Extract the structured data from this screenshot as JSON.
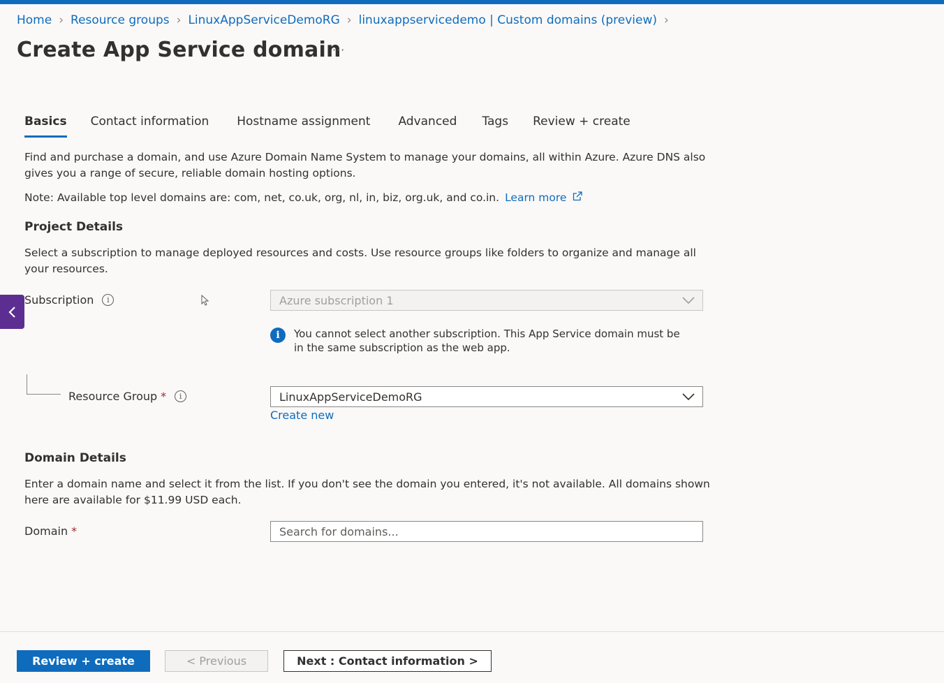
{
  "breadcrumb": {
    "items": [
      "Home",
      "Resource groups",
      "LinuxAppServiceDemoRG",
      "linuxappservicedemo | Custom domains (preview)"
    ]
  },
  "page": {
    "title": "Create App Service domain",
    "more": "···"
  },
  "tabs": [
    {
      "label": "Basics",
      "active": true
    },
    {
      "label": "Contact information"
    },
    {
      "label": "Hostname assignment"
    },
    {
      "label": "Advanced"
    },
    {
      "label": "Tags"
    },
    {
      "label": "Review + create"
    }
  ],
  "intro": {
    "description": "Find and purchase a domain, and use Azure Domain Name System to manage your domains, all within Azure. Azure DNS also gives you a range of secure, reliable domain hosting options.",
    "note": "Note: Available top level domains are: com, net, co.uk, org, nl, in, biz, org.uk, and co.in.",
    "learn_more": "Learn more"
  },
  "project": {
    "heading": "Project Details",
    "description": "Select a subscription to manage deployed resources and costs. Use resource groups like folders to organize and manage all your resources.",
    "subscription_label": "Subscription",
    "subscription_value": "Azure subscription 1",
    "subscription_info": "You cannot select another subscription. This App Service domain must be in the same subscription as the web app.",
    "rg_label": "Resource Group",
    "rg_value": "LinuxAppServiceDemoRG",
    "create_new": "Create new",
    "required_mark": "*",
    "info_glyph": "i"
  },
  "domain": {
    "heading": "Domain Details",
    "description": "Enter a domain name and select it from the list. If you don't see the domain you entered, it's not available. All domains shown here are available for $11.99 USD each.",
    "label": "Domain",
    "placeholder": "Search for domains..."
  },
  "footer": {
    "review_create": "Review + create",
    "previous": "< Previous",
    "next": "Next : Contact information >"
  },
  "colors": {
    "accent": "#0f6cbd",
    "collapse_button": "#5c2e91",
    "required": "#a4262c"
  },
  "icons": {
    "breadcrumb_separator": "chevron-right-icon",
    "dropdown": "chevron-down-icon",
    "external_link": "external-link-icon",
    "info": "info-icon",
    "collapse": "chevron-left-icon"
  }
}
